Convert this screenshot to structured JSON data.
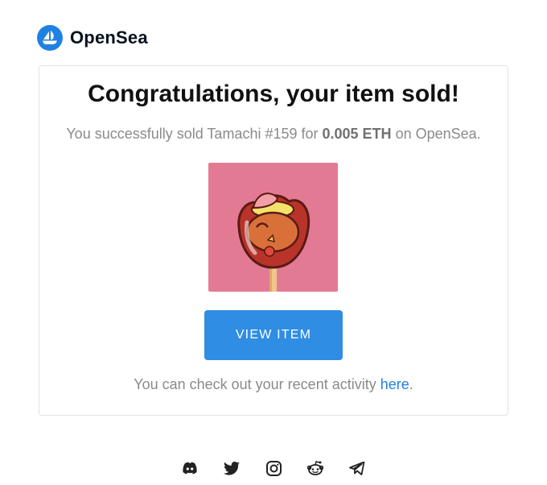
{
  "brand": {
    "name": "OpenSea",
    "logo_icon": "opensea-sailboat-icon",
    "color": "#2081e2"
  },
  "card": {
    "headline": "Congratulations, your item sold!",
    "message": {
      "prefix": "You successfully sold Tamachi #159 for ",
      "price": "0.005 ETH",
      "suffix": " on OpenSea."
    },
    "item_image_icon": "tamachi-candy-apple-chicken-image",
    "view_button_label": "VIEW ITEM",
    "activity": {
      "prefix": "You can check out your recent activity ",
      "link": "here",
      "suffix": "."
    }
  },
  "colors": {
    "accent": "#2081e2",
    "button": "#2f8de4",
    "item_bg": "#e37a94"
  },
  "footer": {
    "icons": [
      "discord-icon",
      "twitter-icon",
      "instagram-icon",
      "reddit-icon",
      "telegram-icon"
    ]
  }
}
